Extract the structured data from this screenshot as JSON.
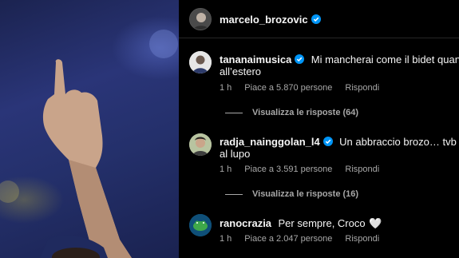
{
  "post": {
    "author": "marcelo_brozovic",
    "author_verified": true
  },
  "comments": [
    {
      "username": "tananaimusica",
      "verified": true,
      "text_line1": "Mi mancherai come il bidet quando",
      "text_line2": "all’estero",
      "time": "1 h",
      "likes": "Piace a 5.870 persone",
      "reply": "Rispondi",
      "view_replies": "Visualizza le risposte (64)"
    },
    {
      "username": "radja_nainggolan_l4",
      "verified": true,
      "text_line1": "Un abbraccio brozo… tvb in",
      "text_line2": "al lupo",
      "time": "1 h",
      "likes": "Piace a 3.591 persone",
      "reply": "Rispondi",
      "view_replies": "Visualizza le risposte (16)"
    },
    {
      "username": "ranocrazia",
      "verified": false,
      "text_line1": "Per sempre, Croco",
      "heart": "🤍",
      "time": "1 h",
      "likes": "Piace a 2.047 persone",
      "reply": "Rispondi"
    }
  ],
  "colors": {
    "verified": "#0095f6",
    "secondary_text": "#a8a8a8",
    "divider": "#262626"
  }
}
